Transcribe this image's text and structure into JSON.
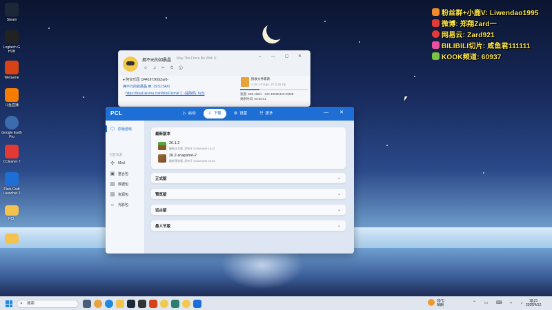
{
  "desktop": {
    "icons": [
      {
        "label": "Steam",
        "icon": "steam-icon",
        "color": "#1b2838"
      },
      {
        "label": "Logitech G HUB",
        "icon": "logitech-icon",
        "color": "#222222"
      },
      {
        "label": "WeGame",
        "icon": "wegame-icon",
        "color": "#d84315"
      },
      {
        "label": "斗鱼直播",
        "icon": "douyu-icon",
        "color": "#f57c00"
      },
      {
        "label": "Google Earth Pro",
        "icon": "earth-icon",
        "color": "#3c6bb0"
      },
      {
        "label": "CCleaner 7",
        "icon": "ccleaner-icon",
        "color": "#e53935"
      },
      {
        "label": "Plain Craft Launcher 2",
        "icon": "pcl-icon",
        "color": "#1d6fd6"
      },
      {
        "label": "PCL",
        "icon": "folder-icon",
        "color": "#f4c24d"
      },
      {
        "label": "",
        "icon": "folder-icon",
        "color": "#f4c24d"
      }
    ]
  },
  "overlay": {
    "lines": [
      {
        "text": "粉丝群+小鹿V: Liwendao1995",
        "color": "#f28a2e"
      },
      {
        "text": "微博: 郑翔Zard一",
        "color": "#e53935"
      },
      {
        "text": "网易云: Zard921",
        "color": "#e53935"
      },
      {
        "text": "BILIBILI切片: 咸鱼君111111",
        "color": "#ec4fa0"
      },
      {
        "text": "KOOK频道: 60937",
        "color": "#7cc242"
      }
    ]
  },
  "qq": {
    "title": "拥不元的如晨晶",
    "subtitle": "May The Force Be With U",
    "tools": "☺ ♫ ✂ ⏱ ⓘ",
    "lines": [
      "● 阿甘乐园 (344187360)Zard-",
      "拥不元的如晨晶 用: 19:51:54/0",
      "https://lzxal.lanzou.com/b0x10zmid ⓘ (提取码: 9z3)"
    ],
    "file": {
      "title": "接收文件邀请",
      "name": "1.28.1-Forge_47.4.20.zip",
      "speed": "速度: 598.4kB/s",
      "size": "122.49MB/420.09MB",
      "remaining": "剩余时间: 00:00:51",
      "progress": 0.29
    }
  },
  "pcl": {
    "logo": "PCL",
    "nav": [
      {
        "label": "启动",
        "icon": "▷",
        "active": false
      },
      {
        "label": "下载",
        "icon": "⇩",
        "active": true
      },
      {
        "label": "设置",
        "icon": "⚙",
        "active": false
      },
      {
        "label": "更多",
        "icon": "☷",
        "active": false
      }
    ],
    "window_controls": "— ✕",
    "sidebar": {
      "main_item": "原版游戏",
      "category": "社区资源",
      "items": [
        "Mod",
        "整合包",
        "数据包",
        "资源包",
        "光影包"
      ]
    },
    "latest": {
      "title": "最新版本",
      "versions": [
        {
          "name": "26.1.2",
          "date": "最新正式版, 发布于 2026/04/09 18:12"
        },
        {
          "name": "26.2-snapshot-2",
          "date": "最新预览版, 发布于 2026/04/09 20:35"
        }
      ]
    },
    "sections": [
      "正式版",
      "预览版",
      "远古版",
      "愚人节版"
    ]
  },
  "taskbar": {
    "search_placeholder": "搜索",
    "weather_temp": "35°C",
    "weather_desc": "晴朗",
    "time": "18:21",
    "date": "2026/4/12"
  }
}
